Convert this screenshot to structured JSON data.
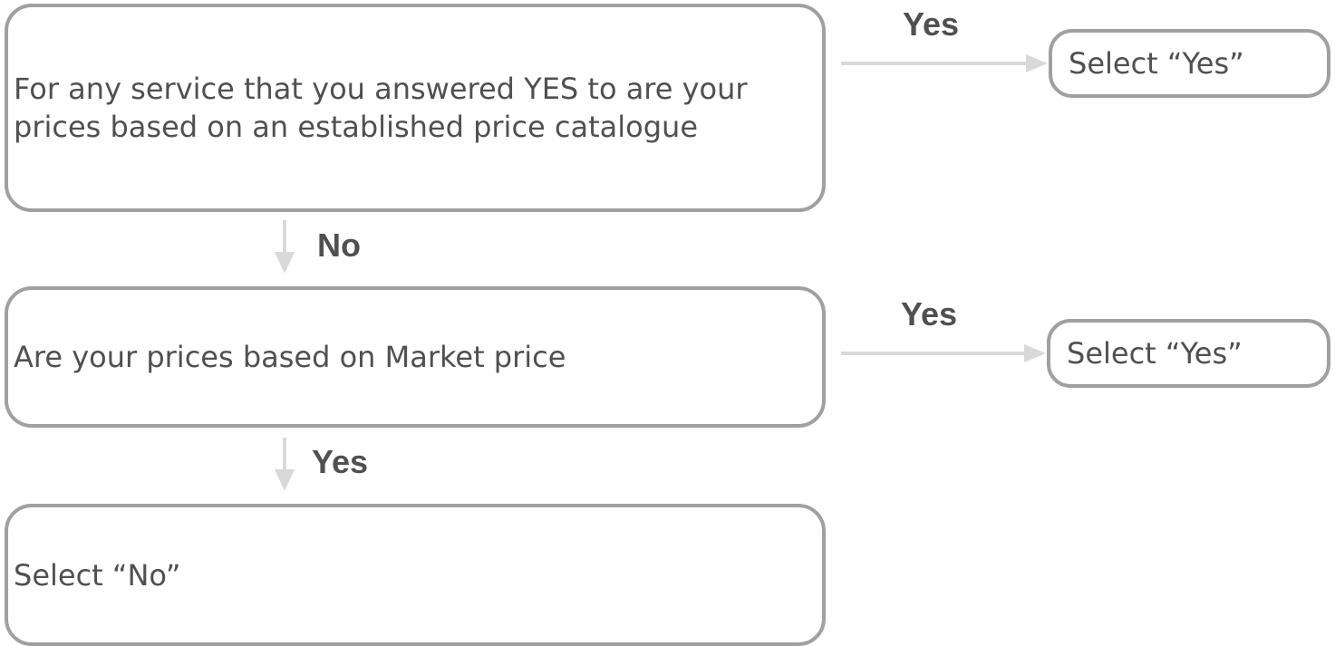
{
  "nodes": {
    "q1": "For any service that you answered YES to are your prices based on an established price catalogue",
    "q2": "Are your prices based on Market price",
    "end_no": "Select “No”",
    "end_yes_1": "Select “Yes”",
    "end_yes_2": "Select “Yes”"
  },
  "edges": {
    "q1_right": "Yes",
    "q1_down": "No",
    "q2_right": "Yes",
    "q2_down": "Yes"
  },
  "colors": {
    "box_border": "#a0a0a0",
    "arrow": "#d9d9d9",
    "text": "#505050"
  }
}
